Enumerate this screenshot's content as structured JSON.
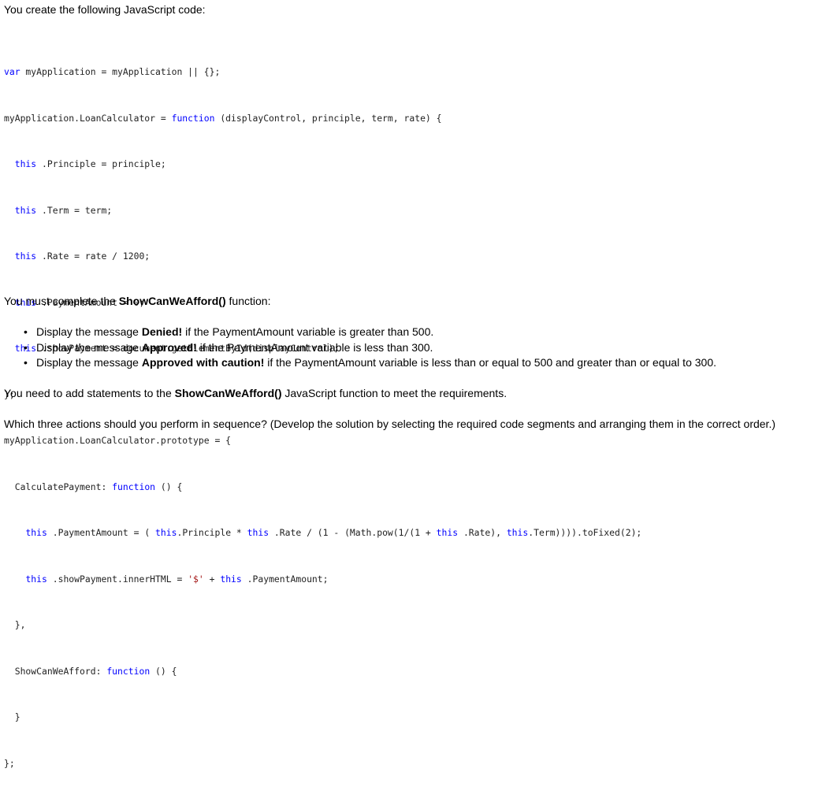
{
  "intro": "You create the following JavaScript code:",
  "code": {
    "line1": {
      "kw": "var",
      "rest": " myApplication = myApplication || {};"
    },
    "line2": {
      "a": "myApplication.LoanCalculator = ",
      "kw": "function",
      "b": " (displayControl, principle, term, rate) {"
    },
    "line3": {
      "kw": "this",
      "rest": " .Principle = principle;"
    },
    "line4": {
      "kw": "this",
      "rest": " .Term = term;"
    },
    "line5": {
      "kw": "this",
      "rest": " .Rate = rate / 1200;"
    },
    "line6": {
      "kw": "this",
      "rest": " .PaymentAmount = 0;"
    },
    "line7": {
      "kw": "this",
      "rest": " .showPayment = document.getElementById(displayControl);"
    },
    "line8": "};",
    "line9": "myApplication.LoanCalculator.prototype = {",
    "line10": {
      "a": "CalculatePayment: ",
      "kw": "function",
      "b": " () {"
    },
    "line11": {
      "kw1": "this",
      "t1": " .PaymentAmount = ( ",
      "kw2": "this",
      "t2": ".Principle * ",
      "kw3": "this",
      "t3": " .Rate / (1 - (Math.pow(1/(1 + ",
      "kw4": "this",
      "t4": " .Rate), ",
      "kw5": "this",
      "t5": ".Term)))).toFixed(2);"
    },
    "line12": {
      "kw1": "this",
      "t1": " .showPayment.innerHTML = ",
      "str": "'$'",
      "t2": " + ",
      "kw2": "this",
      "t3": " .PaymentAmount;"
    },
    "line13": "},",
    "line14": {
      "a": "ShowCanWeAfford: ",
      "kw": "function",
      "b": " () {"
    },
    "line15": "}",
    "line16": "};"
  },
  "complete": {
    "pre": "You must complete the ",
    "bold": "ShowCanWeAfford()",
    "post": " function:"
  },
  "bullets": [
    {
      "pre": "Display the message ",
      "bold": "Denied!",
      "post": " if the PaymentAmount variable is greater than 500."
    },
    {
      "pre": "Display the message ",
      "bold": "Approved!",
      "post": " if the PaymentAmount variable is less than 300."
    },
    {
      "pre": "Display the message ",
      "bold": "Approved with caution!",
      "post": " if the PaymentAmount variable is less than or equal to 500 and greater than or equal to 300."
    }
  ],
  "bullet_glyph": "•",
  "need": {
    "pre": "You need to add statements to the ",
    "bold": "ShowCanWeAfford()",
    "post": " JavaScript function to meet the requirements."
  },
  "which": "Which three actions should you perform in sequence? (Develop the solution by selecting the required code segments and arranging them in the correct order.)"
}
